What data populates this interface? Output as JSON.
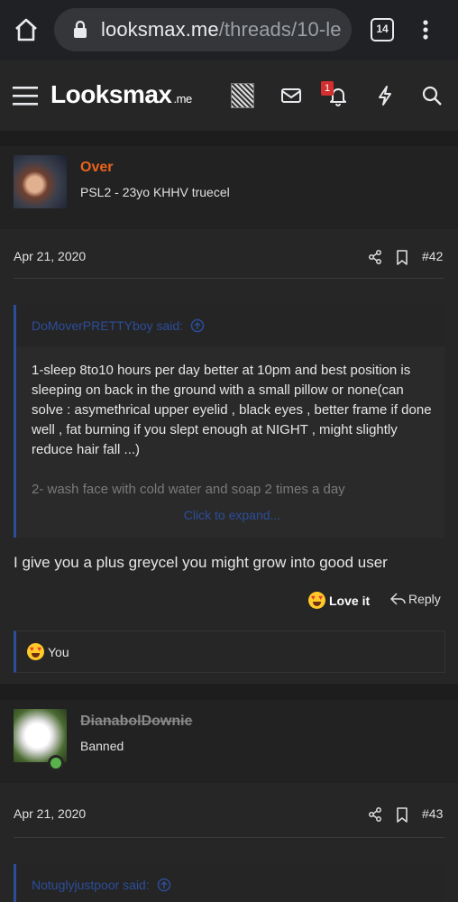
{
  "browser": {
    "url_host": "looksmax.me",
    "url_path": "/threads/10-le",
    "tab_count": "14"
  },
  "site": {
    "logo_text": "Looksmax",
    "logo_suffix": ".me",
    "notification_count": "1"
  },
  "posts": [
    {
      "username": "Over",
      "user_title": "PSL2 - 23yo KHHV truecel",
      "date": "Apr 21, 2020",
      "post_number": "#42",
      "quote": {
        "source": "DoMoverPRETTYboy said:",
        "text": "1-sleep 8to10 hours per day better at 10pm and best position is sleeping on back in the ground with a small pillow or none(can solve : asymethrical upper eyelid , black eyes , better frame if done well , fat burning if you slept enough at NIGHT , might slightly reduce hair fall ...)",
        "faded_text": "2- wash face with cold water and soap 2 times a day",
        "expand_label": "Click to expand..."
      },
      "message": "I give you a plus greycel you might grow into good user",
      "love_label": "Love it",
      "reply_label": "Reply",
      "reacted_by": "You"
    },
    {
      "username": "DianabolDownie",
      "user_title": "Banned",
      "date": "Apr 21, 2020",
      "post_number": "#43",
      "quote": {
        "source": "Notuglyjustpoor said:"
      }
    }
  ],
  "colors": {
    "accent_link": "#2c4d9a",
    "username_orange": "#e8641c",
    "online_green": "#58b44a",
    "badge_red": "#d32f2f"
  }
}
